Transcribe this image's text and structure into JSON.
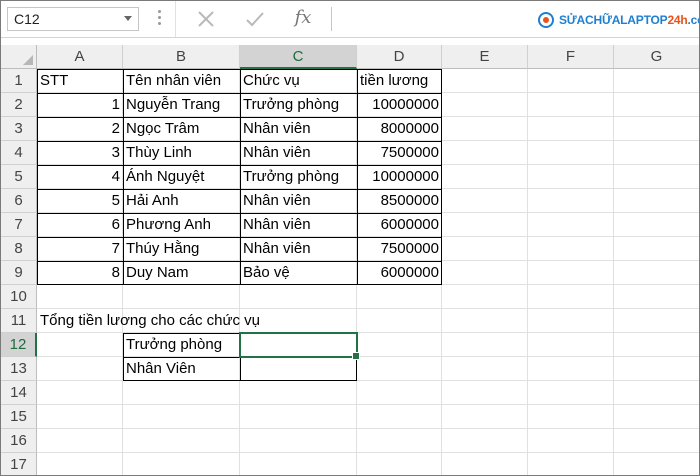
{
  "formula_bar": {
    "name_box": "C12",
    "formula": ""
  },
  "logo": {
    "text_blue": "SỬACHỮALAPTOP",
    "text_orange": "24h",
    "text_tail": ".com"
  },
  "colors": {
    "accent": "#217346",
    "header_bg": "#efefef",
    "selected_header_bg": "#d3d3d3",
    "gridline": "#e0e0e0",
    "logo_blue": "#1f7fd0",
    "logo_orange": "#e8541b"
  },
  "icons": [
    "cancel-icon",
    "enter-icon",
    "function-icon",
    "name-box-dropdown-icon",
    "logo-icon"
  ],
  "columns": [
    "A",
    "B",
    "C",
    "D",
    "E",
    "F",
    "G"
  ],
  "rows": [
    "1",
    "2",
    "3",
    "4",
    "5",
    "6",
    "7",
    "8",
    "9",
    "10",
    "11",
    "12",
    "13",
    "14",
    "15",
    "16",
    "17"
  ],
  "selected_cell": {
    "column": "C",
    "row": "12"
  },
  "cells": {
    "A1": "STT",
    "B1": "Tên nhân viên",
    "C1": "Chức vụ",
    "D1": "tiền lương",
    "A2": "1",
    "B2": "Nguyễn Trang",
    "C2": "Trưởng phòng",
    "D2": "10000000",
    "A3": "2",
    "B3": "Ngọc Trâm",
    "C3": "Nhân viên",
    "D3": "8000000",
    "A4": "3",
    "B4": "Thùy Linh",
    "C4": "Nhân viên",
    "D4": "7500000",
    "A5": "4",
    "B5": "Ánh Nguyệt",
    "C5": "Trưởng phòng",
    "D5": "10000000",
    "A6": "5",
    "B6": "Hải Anh",
    "C6": "Nhân viên",
    "D6": "8500000",
    "A7": "6",
    "B7": "Phương Anh",
    "C7": "Nhân viên",
    "D7": "6000000",
    "A8": "7",
    "B8": "Thúy Hằng",
    "C8": "Nhân viên",
    "D8": "7500000",
    "A9": "8",
    "B9": "Duy Nam",
    "C9": "Bảo vệ",
    "D9": "6000000",
    "A11": "Tổng tiền lương cho các chức vụ",
    "B12": "Trưởng phòng",
    "C12": "",
    "B13": "Nhân Viên",
    "C13": ""
  }
}
